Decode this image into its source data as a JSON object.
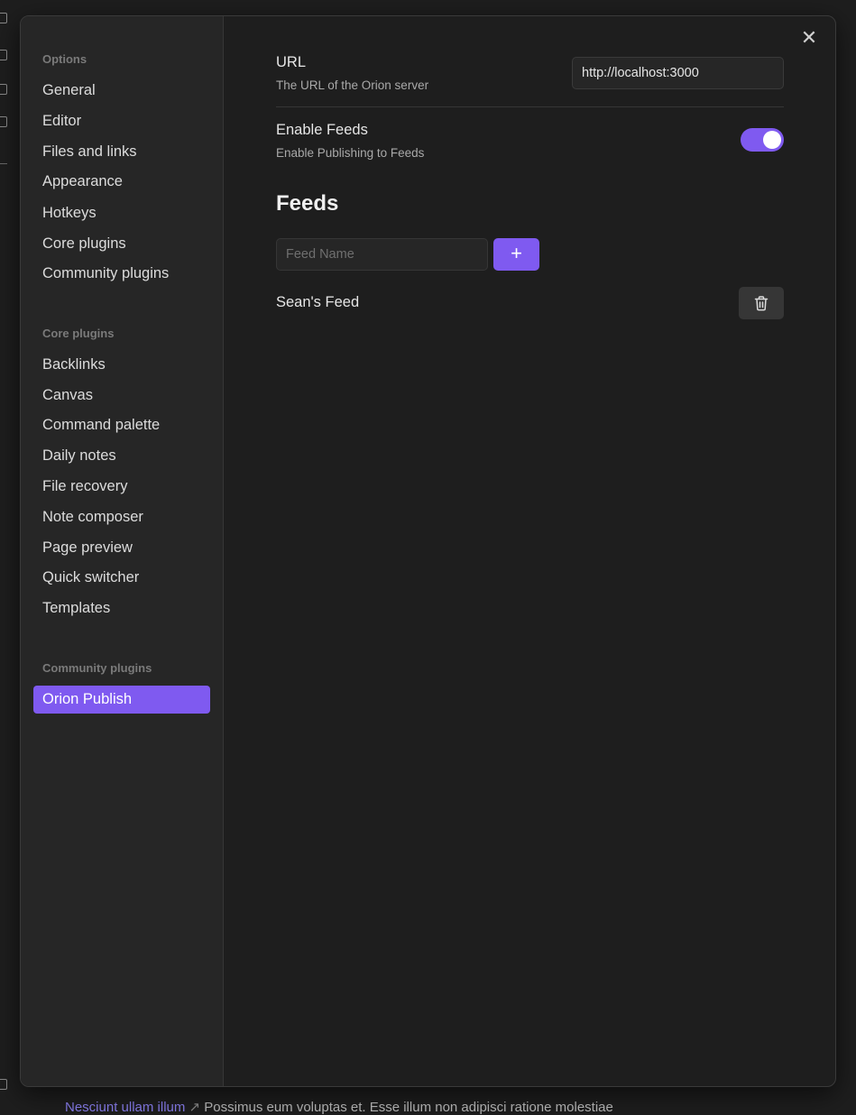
{
  "sidebar": {
    "options_title": "Options",
    "options_items": [
      "General",
      "Editor",
      "Files and links",
      "Appearance",
      "Hotkeys",
      "Core plugins",
      "Community plugins"
    ],
    "core_title": "Core plugins",
    "core_items": [
      "Backlinks",
      "Canvas",
      "Command palette",
      "Daily notes",
      "File recovery",
      "Note composer",
      "Page preview",
      "Quick switcher",
      "Templates"
    ],
    "community_title": "Community plugins",
    "community_items": [
      "Orion Publish"
    ],
    "active_item": "Orion Publish"
  },
  "settings": {
    "url": {
      "name": "URL",
      "description": "The URL of the Orion server",
      "value": "http://localhost:3000"
    },
    "enable_feeds": {
      "name": "Enable Feeds",
      "description": "Enable Publishing to Feeds",
      "enabled": true
    }
  },
  "feeds": {
    "heading": "Feeds",
    "input_placeholder": "Feed Name",
    "add_label": "+",
    "items": [
      {
        "name": "Sean's Feed"
      }
    ]
  },
  "close_label": "✕",
  "background_text": {
    "link": "Nesciunt ullam illum",
    "rest": "Possimus eum voluptas et. Esse illum non adipisci ratione molestiae"
  },
  "colors": {
    "accent": "#7f5af0",
    "background": "#1e1e1e",
    "sidebar": "#262626"
  },
  "icons": {
    "close": "close-icon",
    "add": "plus-icon",
    "delete": "trash-icon"
  }
}
